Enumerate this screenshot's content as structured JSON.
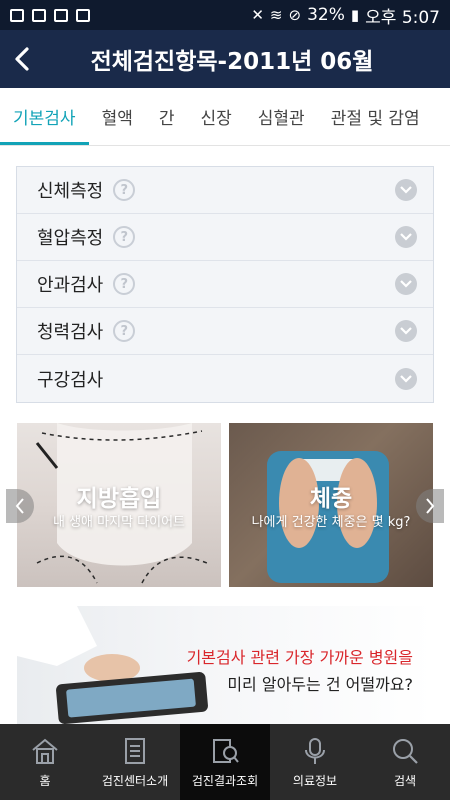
{
  "status_bar": {
    "battery": "32%",
    "time": "오후 5:07"
  },
  "header": {
    "title": "전체검진항목-2011년 06월"
  },
  "tabs": [
    {
      "label": "기본검사",
      "active": true
    },
    {
      "label": "혈액"
    },
    {
      "label": "간"
    },
    {
      "label": "신장"
    },
    {
      "label": "심혈관"
    },
    {
      "label": "관절 및 감염"
    }
  ],
  "accordion": [
    {
      "label": "신체측정"
    },
    {
      "label": "혈압측정"
    },
    {
      "label": "안과검사"
    },
    {
      "label": "청력검사"
    },
    {
      "label": "구강검사"
    }
  ],
  "help_glyph": "?",
  "banners": [
    {
      "title": "지방흡입",
      "subtitle": "내 생애 마지막 다이어트"
    },
    {
      "title": "체중",
      "subtitle": "나에게 건강한 체중은 몇 kg?"
    }
  ],
  "promo": {
    "line1": "기본검사 관련 가장 가까운 병원을",
    "line2": "미리 알아두는 건 어떨까요?"
  },
  "bottom_nav": [
    {
      "label": "홈",
      "icon": "home-icon"
    },
    {
      "label": "검진센터소개",
      "icon": "document-icon"
    },
    {
      "label": "검진결과조회",
      "icon": "search-result-icon",
      "active": true
    },
    {
      "label": "의료정보",
      "icon": "microphone-icon"
    },
    {
      "label": "검색",
      "icon": "search-icon"
    }
  ],
  "colors": {
    "header": "#1a2a4a",
    "status": "#0f1a2e",
    "accent": "#12a3b7",
    "promo_red": "#d9262b",
    "nav": "#2b2b2b"
  }
}
